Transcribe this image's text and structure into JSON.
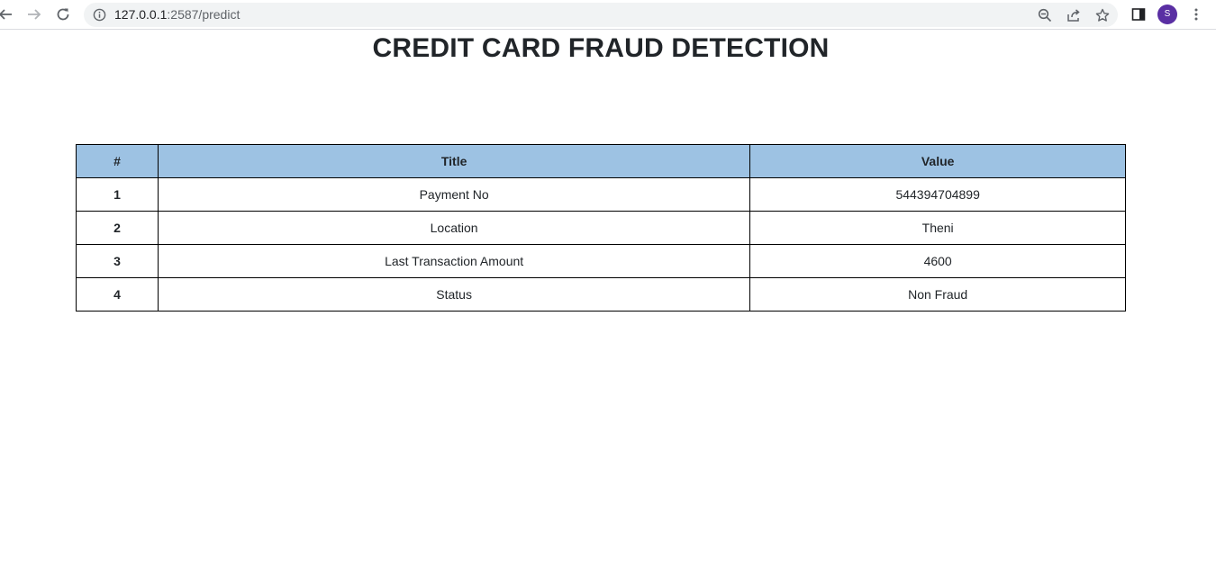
{
  "browser": {
    "url_host": "127.0.0.1",
    "url_rest": ":2587/predict",
    "profile_initial": "S",
    "icons": [
      "back-icon",
      "forward-icon",
      "reload-icon",
      "info-icon",
      "zoom-icon",
      "share-icon",
      "star-icon",
      "side-panel-icon",
      "more-icon"
    ]
  },
  "page": {
    "title": "CREDIT CARD FRAUD DETECTION"
  },
  "table": {
    "headers": [
      "#",
      "Title",
      "Value"
    ],
    "rows": [
      {
        "num": "1",
        "title": "Payment No",
        "value": "544394704899"
      },
      {
        "num": "2",
        "title": "Location",
        "value": "Theni"
      },
      {
        "num": "3",
        "title": "Last Transaction Amount",
        "value": "4600"
      },
      {
        "num": "4",
        "title": "Status",
        "value": "Non Fraud"
      }
    ]
  },
  "colors": {
    "header_bg": "#9dc2e3",
    "avatar_bg": "#5a2fa3",
    "omnibox_bg": "#f1f3f4"
  }
}
